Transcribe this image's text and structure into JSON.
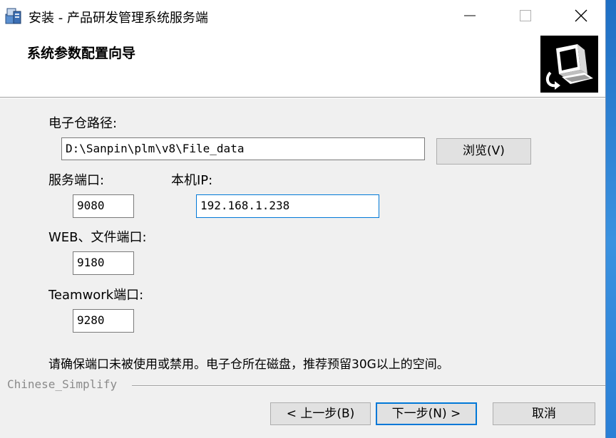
{
  "window": {
    "title": "安装 - 产品研发管理系统服务端",
    "icons": {
      "app": "installer-icon",
      "minimize": "minimize-icon",
      "maximize": "maximize-icon",
      "close": "close-icon"
    }
  },
  "header": {
    "title": "系统参数配置向导",
    "logo_icon": "computer-install-icon"
  },
  "form": {
    "vault_path_label": "电子仓路径:",
    "vault_path_value": "D:\\Sanpin\\plm\\v8\\File_data",
    "browse_label": "浏览(V)",
    "service_port_label": "服务端口:",
    "service_port_value": "9080",
    "local_ip_label": "本机IP:",
    "local_ip_value": "192.168.1.238",
    "web_port_label": "WEB、文件端口:",
    "web_port_value": "9180",
    "teamwork_port_label": "Teamwork端口:",
    "teamwork_port_value": "9280",
    "notice": "请确保端口未被使用或禁用。电子仓所在磁盘，推荐预留30G以上的空间。"
  },
  "footer": {
    "language": "Chinese_Simplify",
    "back_label": "< 上一步(B)",
    "next_label": "下一步(N) >",
    "cancel_label": "取消"
  },
  "colors": {
    "dialog_bg": "#f0f0f0",
    "focus_accent": "#0078d7",
    "desktop": "#2b7fd4"
  }
}
